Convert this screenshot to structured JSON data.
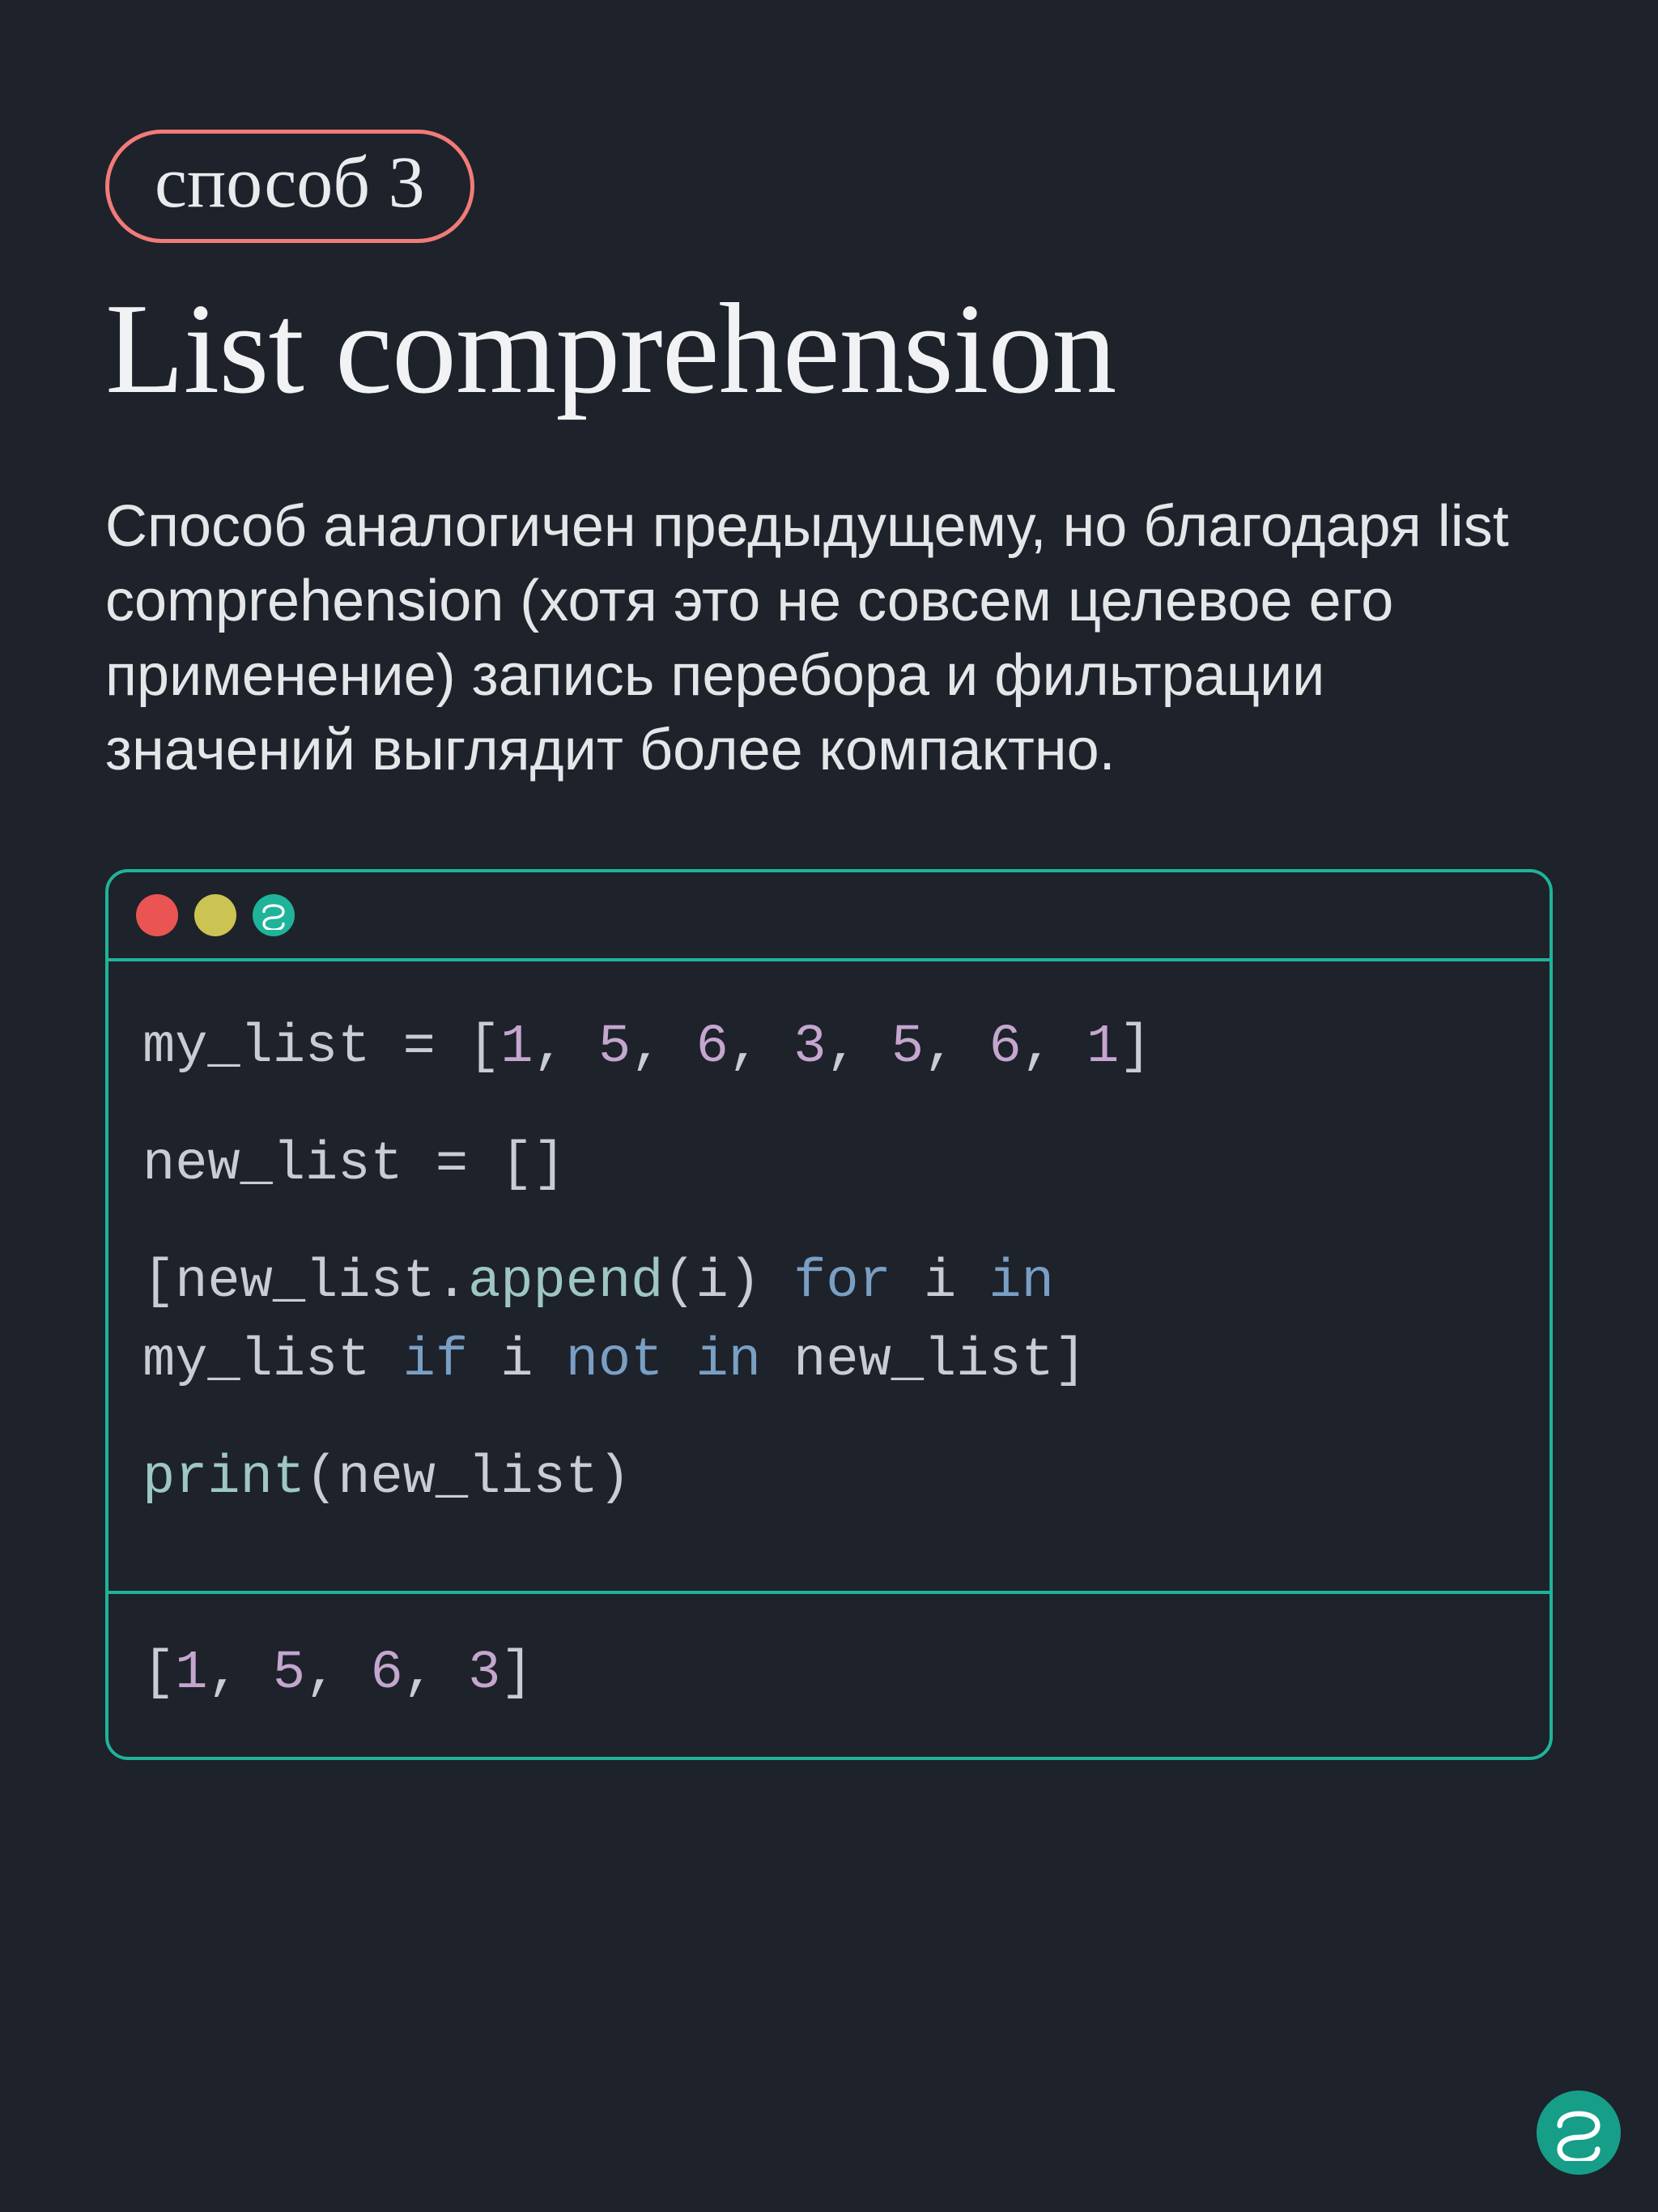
{
  "badge": "способ 3",
  "title": "List comprehension",
  "description": "Способ аналогичен предыдущему, но благодаря list comprehension (хотя это не совсем целевое его применение) запись перебора и фильтрации значений выглядит более компактно.",
  "code": {
    "lines": [
      [
        {
          "t": "my_list ",
          "c": "default"
        },
        {
          "t": "=",
          "c": "op"
        },
        {
          "t": " [",
          "c": "default"
        },
        {
          "t": "1",
          "c": "num"
        },
        {
          "t": ", ",
          "c": "default"
        },
        {
          "t": "5",
          "c": "num"
        },
        {
          "t": ", ",
          "c": "default"
        },
        {
          "t": "6",
          "c": "num"
        },
        {
          "t": ", ",
          "c": "default"
        },
        {
          "t": "3",
          "c": "num"
        },
        {
          "t": ", ",
          "c": "default"
        },
        {
          "t": "5",
          "c": "num"
        },
        {
          "t": ", ",
          "c": "default"
        },
        {
          "t": "6",
          "c": "num"
        },
        {
          "t": ", ",
          "c": "default"
        },
        {
          "t": "1",
          "c": "num"
        },
        {
          "t": "]",
          "c": "default"
        }
      ],
      "gap",
      [
        {
          "t": "new_list ",
          "c": "default"
        },
        {
          "t": "=",
          "c": "op"
        },
        {
          "t": " []",
          "c": "default"
        }
      ],
      "gap",
      [
        {
          "t": "[new_list.",
          "c": "default"
        },
        {
          "t": "append",
          "c": "func"
        },
        {
          "t": "(i) ",
          "c": "default"
        },
        {
          "t": "for",
          "c": "kw"
        },
        {
          "t": " i ",
          "c": "default"
        },
        {
          "t": "in",
          "c": "kw"
        },
        {
          "t": " ",
          "c": "default"
        }
      ],
      [
        {
          "t": "my_list ",
          "c": "default"
        },
        {
          "t": "if",
          "c": "kw"
        },
        {
          "t": " i ",
          "c": "default"
        },
        {
          "t": "not",
          "c": "kw"
        },
        {
          "t": " ",
          "c": "default"
        },
        {
          "t": "in",
          "c": "kw"
        },
        {
          "t": " new_list]",
          "c": "default"
        }
      ],
      "gap",
      [
        {
          "t": "print",
          "c": "func"
        },
        {
          "t": "(new_list)",
          "c": "default"
        }
      ]
    ],
    "output": [
      [
        {
          "t": "[",
          "c": "default"
        },
        {
          "t": "1",
          "c": "num"
        },
        {
          "t": ", ",
          "c": "default"
        },
        {
          "t": "5",
          "c": "num"
        },
        {
          "t": ", ",
          "c": "default"
        },
        {
          "t": "6",
          "c": "num"
        },
        {
          "t": ", ",
          "c": "default"
        },
        {
          "t": "3",
          "c": "num"
        },
        {
          "t": "]",
          "c": "default"
        }
      ]
    ]
  }
}
